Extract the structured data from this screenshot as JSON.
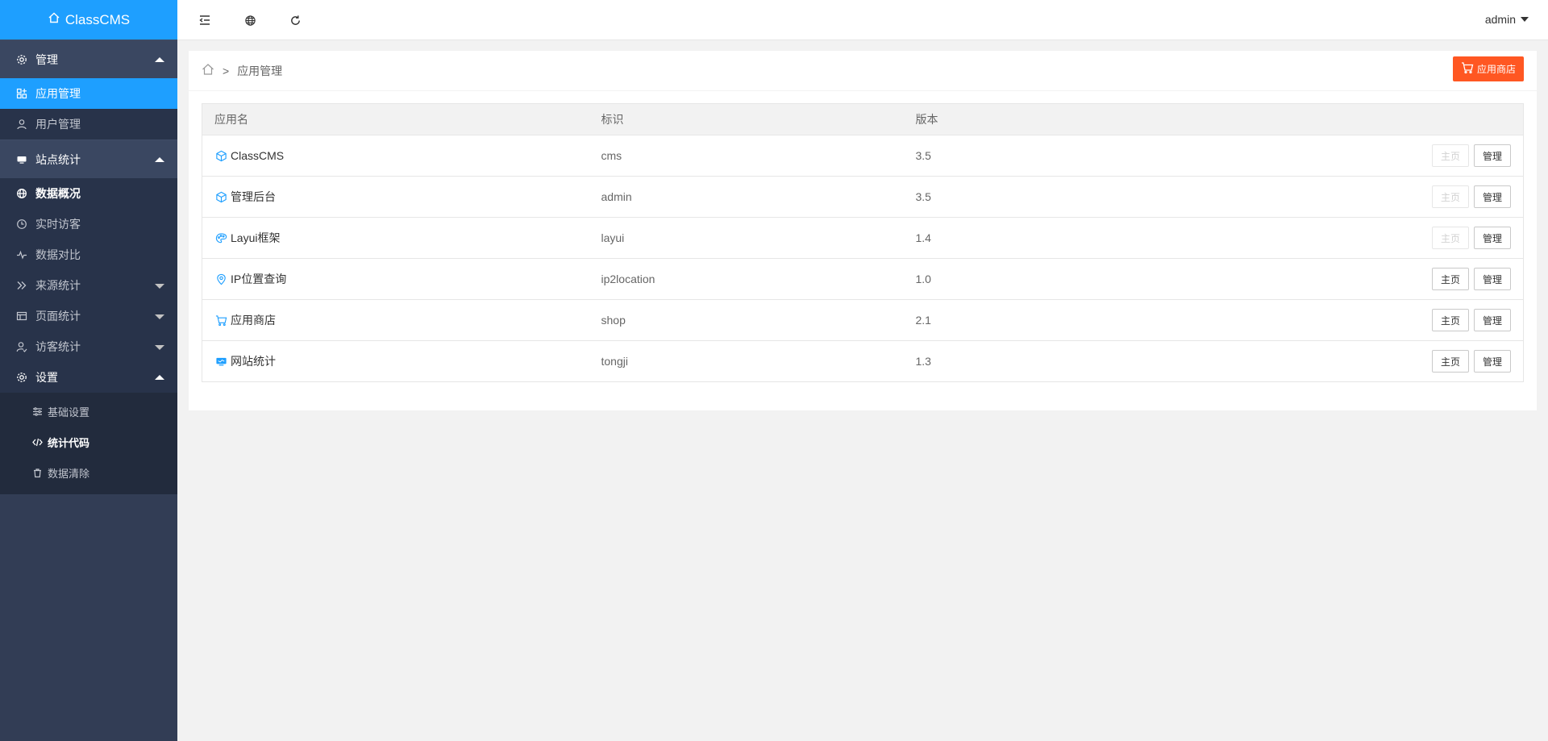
{
  "logo": {
    "title": "ClassCMS"
  },
  "sidebar": {
    "groups": [
      {
        "label": "管理"
      },
      {
        "label": "站点统计"
      },
      {
        "label": "设置"
      }
    ],
    "items": {
      "app_manage": "应用管理",
      "user_manage": "用户管理",
      "data_overview": "数据概况",
      "realtime": "实时访客",
      "compare": "数据对比",
      "source": "来源统计",
      "page": "页面统计",
      "visitor": "访客统计",
      "basic_settings": "基础设置",
      "stat_code": "统计代码",
      "data_clear": "数据清除"
    }
  },
  "header": {
    "user": "admin"
  },
  "breadcrumb": {
    "sep": ">",
    "current": "应用管理"
  },
  "shop_button": "应用商店",
  "table": {
    "headers": [
      "应用名",
      "标识",
      "版本"
    ],
    "rows": [
      {
        "name": "ClassCMS",
        "id": "cms",
        "version": "3.5",
        "icon": "cube-icon",
        "home_enabled": false
      },
      {
        "name": "管理后台",
        "id": "admin",
        "version": "3.5",
        "icon": "cube-icon",
        "home_enabled": false
      },
      {
        "name": "Layui框架",
        "id": "layui",
        "version": "1.4",
        "icon": "palette-icon",
        "home_enabled": false
      },
      {
        "name": "IP位置查询",
        "id": "ip2location",
        "version": "1.0",
        "icon": "location-icon",
        "home_enabled": true
      },
      {
        "name": "应用商店",
        "id": "shop",
        "version": "2.1",
        "icon": "cart-icon",
        "home_enabled": true
      },
      {
        "name": "网站统计",
        "id": "tongji",
        "version": "1.3",
        "icon": "monitor-icon",
        "home_enabled": true
      }
    ],
    "home_label": "主页",
    "manage_label": "管理"
  },
  "colors": {
    "accent": "#1E9FFF",
    "shop": "#FF5722",
    "sidebar": "#323d55"
  }
}
